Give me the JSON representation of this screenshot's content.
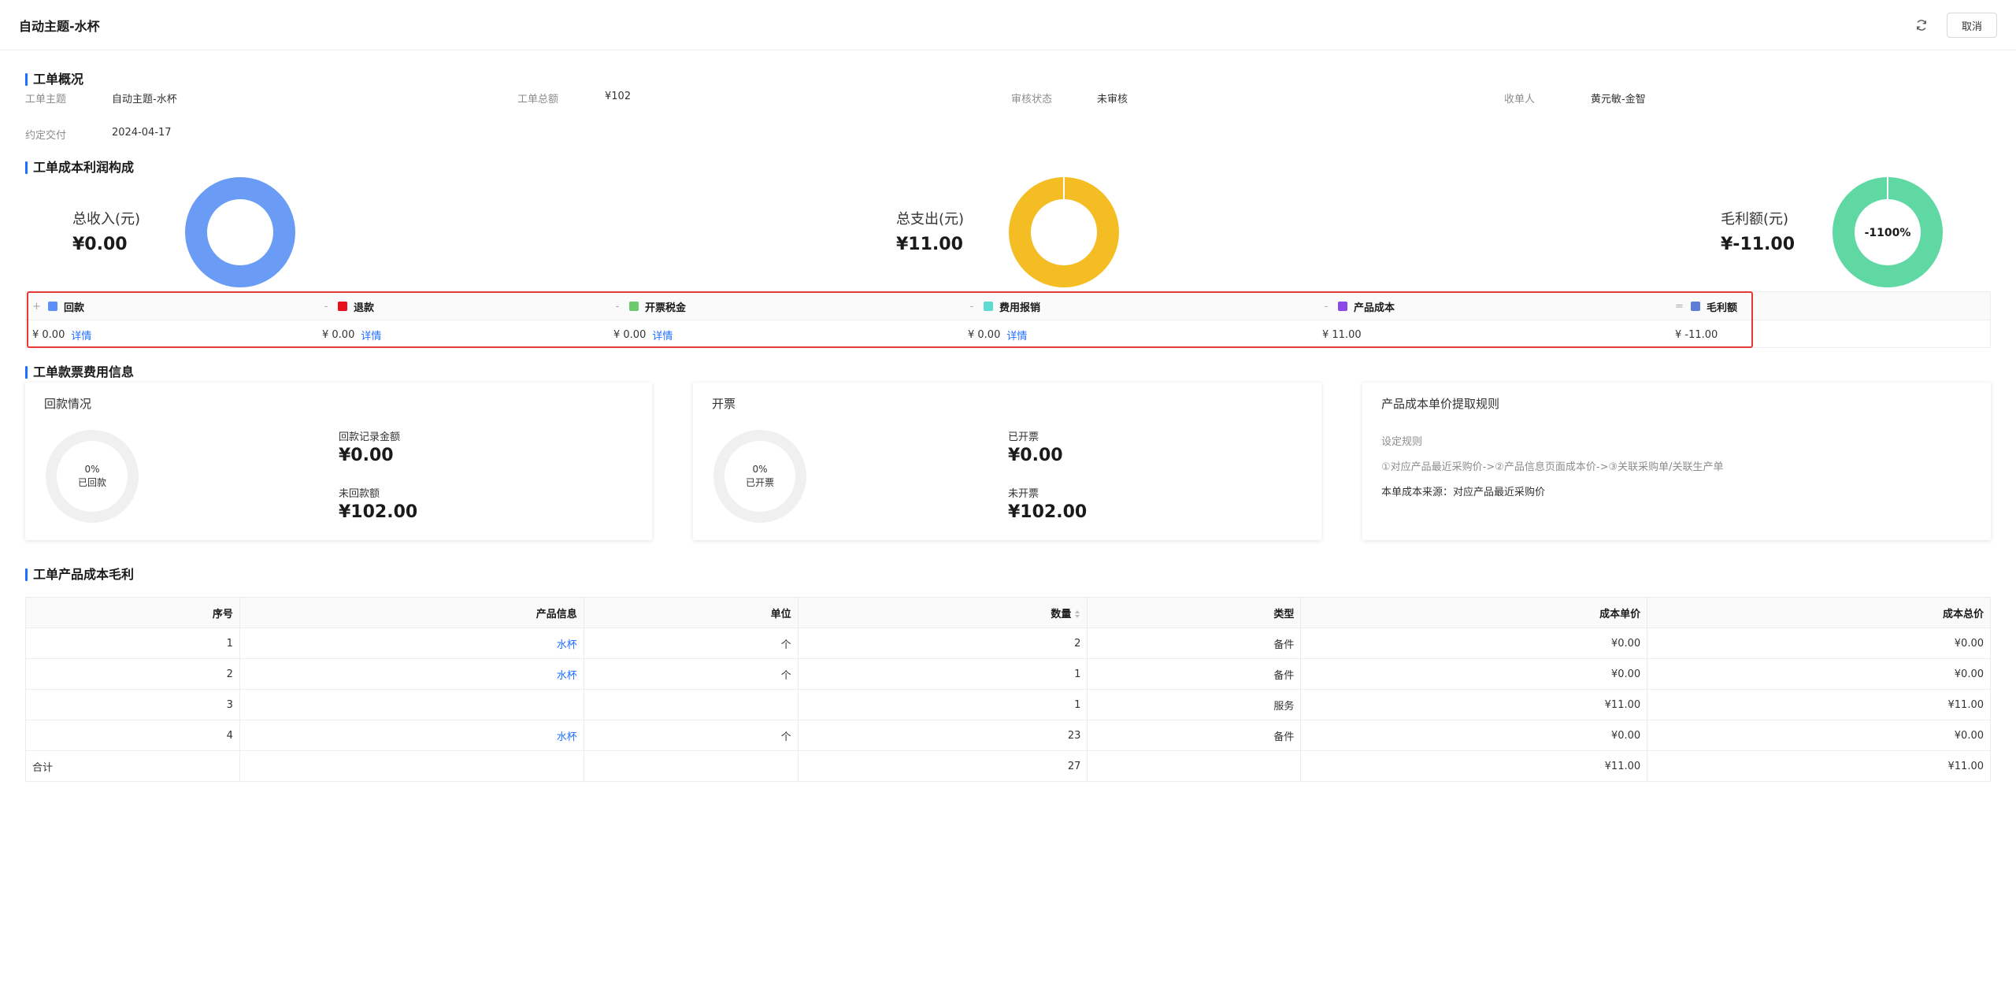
{
  "header": {
    "title": "自动主题-水杯",
    "cancel_label": "取消"
  },
  "overview": {
    "section_title": "工单概况",
    "fields": [
      {
        "label": "工单主题",
        "value": "自动主题-水杯"
      },
      {
        "label": "工单总额",
        "value": "¥102"
      },
      {
        "label": "审核状态",
        "value": "未审核"
      },
      {
        "label": "收单人",
        "value": "黄元敏-金智"
      },
      {
        "label": "约定交付",
        "value": "2024-04-17"
      }
    ]
  },
  "profit": {
    "section_title": "工单成本利润构成",
    "stats": [
      {
        "label": "总收入(元)",
        "value": "¥0.00",
        "color": "#6a9cf5"
      },
      {
        "label": "总支出(元)",
        "value": "¥11.00",
        "color": "#f5bd24"
      },
      {
        "label": "毛利额(元)",
        "value": "¥-11.00",
        "color": "#5fd8a3",
        "center_text": "-1100%"
      }
    ],
    "legend": [
      {
        "sign": "+",
        "name": "回款",
        "color": "#5b8ff9",
        "value": "¥ 0.00",
        "link": "详情"
      },
      {
        "sign": "-",
        "name": "退款",
        "color": "#e8101c",
        "value": "¥ 0.00",
        "link": "详情"
      },
      {
        "sign": "-",
        "name": "开票税金",
        "color": "#6dc96d",
        "value": "¥ 0.00",
        "link": "详情"
      },
      {
        "sign": "-",
        "name": "费用报销",
        "color": "#5cdbd3",
        "value": "¥ 0.00",
        "link": "详情"
      },
      {
        "sign": "-",
        "name": "产品成本",
        "color": "#8b49e6",
        "value": "¥ 11.00",
        "link": ""
      },
      {
        "sign": "=",
        "name": "毛利额",
        "color": "#5b7fd6",
        "value": "¥ -11.00",
        "link": ""
      }
    ]
  },
  "payments": {
    "section_title": "工单款票费用信息",
    "collection": {
      "title": "回款情况",
      "ring_percent": "0%",
      "ring_label": "已回款",
      "recorded_label": "回款记录金额",
      "recorded_value": "¥0.00",
      "pending_label": "未回款额",
      "pending_value": "¥102.00"
    },
    "invoice": {
      "title": "开票",
      "ring_percent": "0%",
      "ring_label": "已开票",
      "issued_label": "已开票",
      "issued_value": "¥0.00",
      "unissued_label": "未开票",
      "unissued_value": "¥102.00"
    },
    "rule": {
      "title": "产品成本单价提取规则",
      "subtitle": "设定规则",
      "rule_text": "①对应产品最近采购价->②产品信息页面成本价->③关联采购单/关联生产单",
      "source_text": "本单成本来源：对应产品最近采购价"
    }
  },
  "products": {
    "section_title": "工单产品成本毛利",
    "columns": [
      "序号",
      "产品信息",
      "单位",
      "数量",
      "类型",
      "成本单价",
      "成本总价"
    ],
    "rows": [
      [
        "1",
        "水杯",
        "个",
        "2",
        "备件",
        "¥0.00",
        "¥0.00"
      ],
      [
        "2",
        "水杯",
        "个",
        "1",
        "备件",
        "¥0.00",
        "¥0.00"
      ],
      [
        "3",
        "",
        "",
        "1",
        "服务",
        "¥11.00",
        "¥11.00"
      ],
      [
        "4",
        "水杯",
        "个",
        "23",
        "备件",
        "¥0.00",
        "¥0.00"
      ]
    ],
    "total": [
      "合计",
      "",
      "",
      "27",
      "",
      "¥11.00",
      "¥11.00"
    ]
  },
  "icons": {
    "refresh": "refresh-icon",
    "sort": "sort-icon"
  }
}
